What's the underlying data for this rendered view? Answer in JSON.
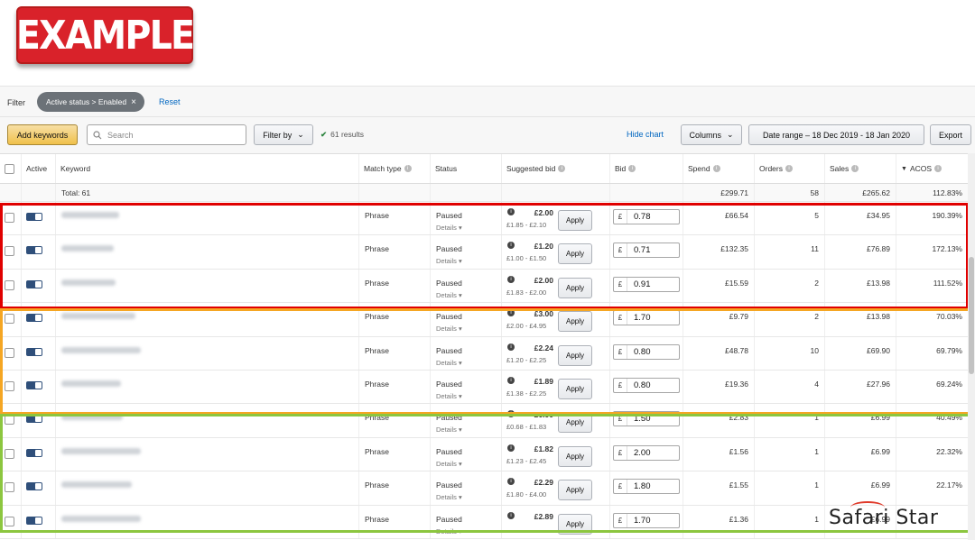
{
  "banner": {
    "label": "EXAMPLE"
  },
  "filter": {
    "label": "Filter",
    "chip": "Active status > Enabled",
    "reset": "Reset"
  },
  "toolbar": {
    "add_keywords": "Add keywords",
    "search_placeholder": "Search",
    "filter_by": "Filter by",
    "results": "61 results",
    "hide_chart": "Hide chart",
    "columns": "Columns",
    "date_range": "Date range – 18 Dec 2019 - 18 Jan 2020",
    "export": "Export"
  },
  "table": {
    "headers": {
      "active": "Active",
      "keyword": "Keyword",
      "match_type": "Match type",
      "status": "Status",
      "suggested_bid": "Suggested bid",
      "bid": "Bid",
      "spend": "Spend",
      "orders": "Orders",
      "sales": "Sales",
      "acos": "ACOS"
    },
    "total": {
      "label": "Total: 61",
      "spend": "£299.71",
      "orders": "58",
      "sales": "£265.62",
      "acos": "112.83%"
    },
    "currency": "£",
    "apply_label": "Apply",
    "details_label": "Details",
    "rows": [
      {
        "match": "Phrase",
        "status": "Paused",
        "sugg": "£2.00",
        "range": "£1.85 - £2.10",
        "bid": "0.78",
        "spend": "£66.54",
        "orders": "5",
        "sales": "£34.95",
        "acos": "190.39%"
      },
      {
        "match": "Phrase",
        "status": "Paused",
        "sugg": "£1.20",
        "range": "£1.00 - £1.50",
        "bid": "0.71",
        "spend": "£132.35",
        "orders": "11",
        "sales": "£76.89",
        "acos": "172.13%"
      },
      {
        "match": "Phrase",
        "status": "Paused",
        "sugg": "£2.00",
        "range": "£1.83 - £2.00",
        "bid": "0.91",
        "spend": "£15.59",
        "orders": "2",
        "sales": "£13.98",
        "acos": "111.52%"
      },
      {
        "match": "Phrase",
        "status": "Paused",
        "sugg": "£3.00",
        "range": "£2.00 - £4.95",
        "bid": "1.70",
        "spend": "£9.79",
        "orders": "2",
        "sales": "£13.98",
        "acos": "70.03%"
      },
      {
        "match": "Phrase",
        "status": "Paused",
        "sugg": "£2.24",
        "range": "£1.20 - £2.25",
        "bid": "0.80",
        "spend": "£48.78",
        "orders": "10",
        "sales": "£69.90",
        "acos": "69.79%"
      },
      {
        "match": "Phrase",
        "status": "Paused",
        "sugg": "£1.89",
        "range": "£1.38 - £2.25",
        "bid": "0.80",
        "spend": "£19.36",
        "orders": "4",
        "sales": "£27.96",
        "acos": "69.24%"
      },
      {
        "match": "Phrase",
        "status": "Paused",
        "sugg": "£0.90",
        "range": "£0.68 - £1.83",
        "bid": "1.50",
        "spend": "£2.83",
        "orders": "1",
        "sales": "£6.99",
        "acos": "40.49%"
      },
      {
        "match": "Phrase",
        "status": "Paused",
        "sugg": "£1.82",
        "range": "£1.23 - £2.45",
        "bid": "2.00",
        "spend": "£1.56",
        "orders": "1",
        "sales": "£6.99",
        "acos": "22.32%"
      },
      {
        "match": "Phrase",
        "status": "Paused",
        "sugg": "£2.29",
        "range": "£1.80 - £4.00",
        "bid": "1.80",
        "spend": "£1.55",
        "orders": "1",
        "sales": "£6.99",
        "acos": "22.17%"
      },
      {
        "match": "Phrase",
        "status": "Paused",
        "sugg": "£2.89",
        "range": "",
        "bid": "1.70",
        "spend": "£1.36",
        "orders": "1",
        "sales": "£6.99",
        "acos": ""
      }
    ]
  },
  "watermark": "Safari Star",
  "colors": {
    "red_box": "#e00000",
    "orange_box": "#f5a623",
    "green_box": "#8cc63f",
    "toggle": "#2f4f7a",
    "link": "#0066c0"
  }
}
